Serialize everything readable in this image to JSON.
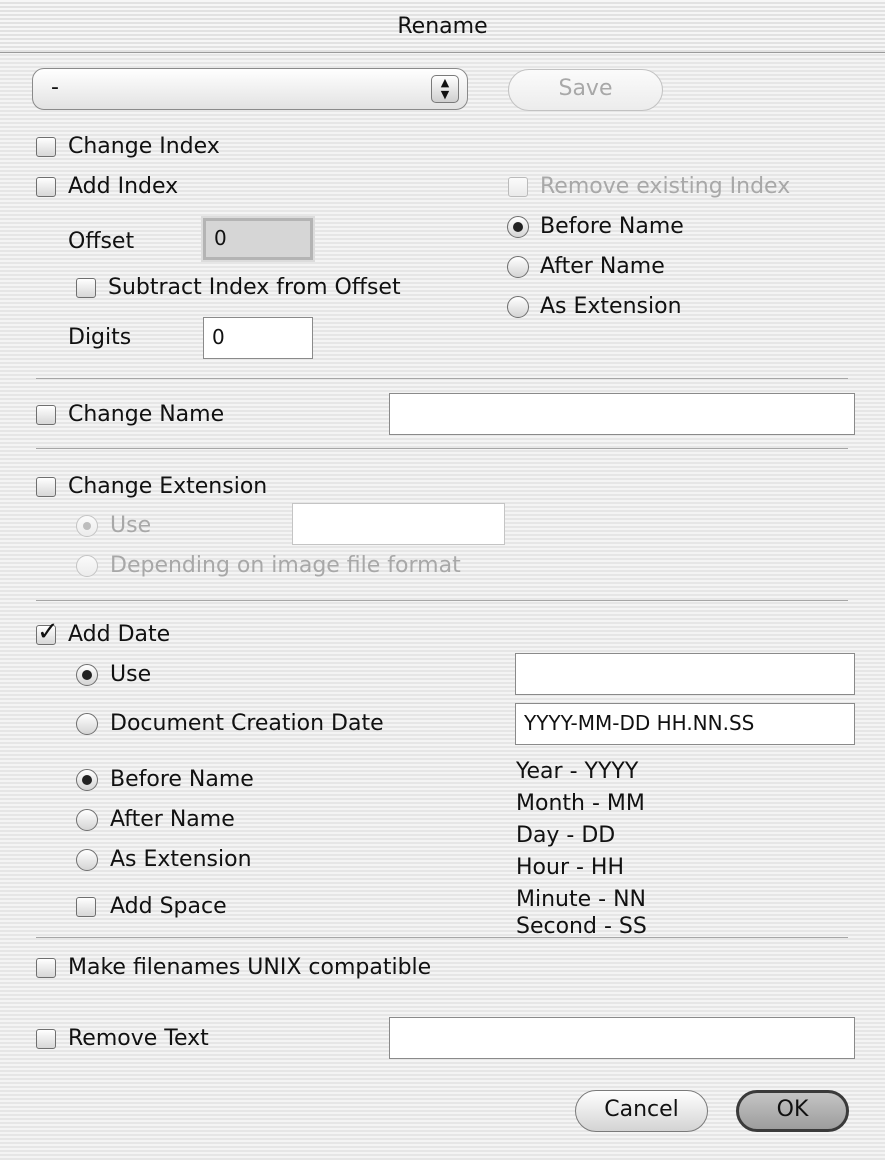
{
  "window": {
    "title": "Rename"
  },
  "preset": {
    "value": "-",
    "save_label": "Save"
  },
  "index": {
    "change_index_label": "Change Index",
    "add_index_label": "Add Index",
    "remove_existing_label": "Remove existing Index",
    "offset_label": "Offset",
    "offset_value": "0",
    "subtract_label": "Subtract Index from Offset",
    "digits_label": "Digits",
    "digits_value": "0",
    "position_options": [
      "Before Name",
      "After Name",
      "As Extension"
    ],
    "position_selected": "Before Name"
  },
  "name": {
    "change_name_label": "Change Name",
    "value": ""
  },
  "extension": {
    "change_extension_label": "Change Extension",
    "use_label": "Use",
    "use_value": "",
    "depending_label": "Depending on image file format"
  },
  "date": {
    "add_date_label": "Add Date",
    "add_date_checked": true,
    "use_label": "Use",
    "use_value": "",
    "doc_creation_label": "Document Creation Date",
    "format_value": "YYYY-MM-DD HH.NN.SS",
    "position_options": [
      "Before Name",
      "After Name",
      "As Extension"
    ],
    "position_selected": "Before Name",
    "add_space_label": "Add Space",
    "legend": [
      "Year - YYYY",
      "Month - MM",
      "Day - DD",
      "Hour - HH",
      "Minute - NN",
      "Second - SS"
    ]
  },
  "unix": {
    "label": "Make filenames UNIX compatible"
  },
  "remove_text": {
    "label": "Remove Text",
    "value": ""
  },
  "buttons": {
    "cancel": "Cancel",
    "ok": "OK"
  }
}
